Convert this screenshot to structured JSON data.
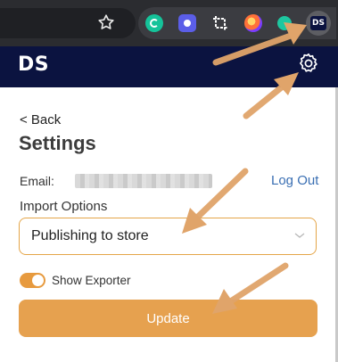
{
  "browser": {
    "extensions": [
      "grammarly-icon",
      "extension-icon",
      "crop-icon",
      "firefox-icon",
      "teal-extension-icon",
      "ds-extension-icon"
    ],
    "ds_badge": "DS"
  },
  "header": {
    "logo": "DS"
  },
  "settings": {
    "back_label": "< Back",
    "title": "Settings",
    "email_label": "Email:",
    "logout_label": "Log Out",
    "import_label": "Import Options",
    "import_selected": "Publishing to store",
    "toggle_label": "Show Exporter",
    "toggle_on": true,
    "update_label": "Update"
  },
  "colors": {
    "header_bg": "#0b1340",
    "accent": "#e6a14f",
    "select_border": "#e4a548",
    "link": "#3a6fb3",
    "annotation_arrow": "#e0a46a"
  }
}
